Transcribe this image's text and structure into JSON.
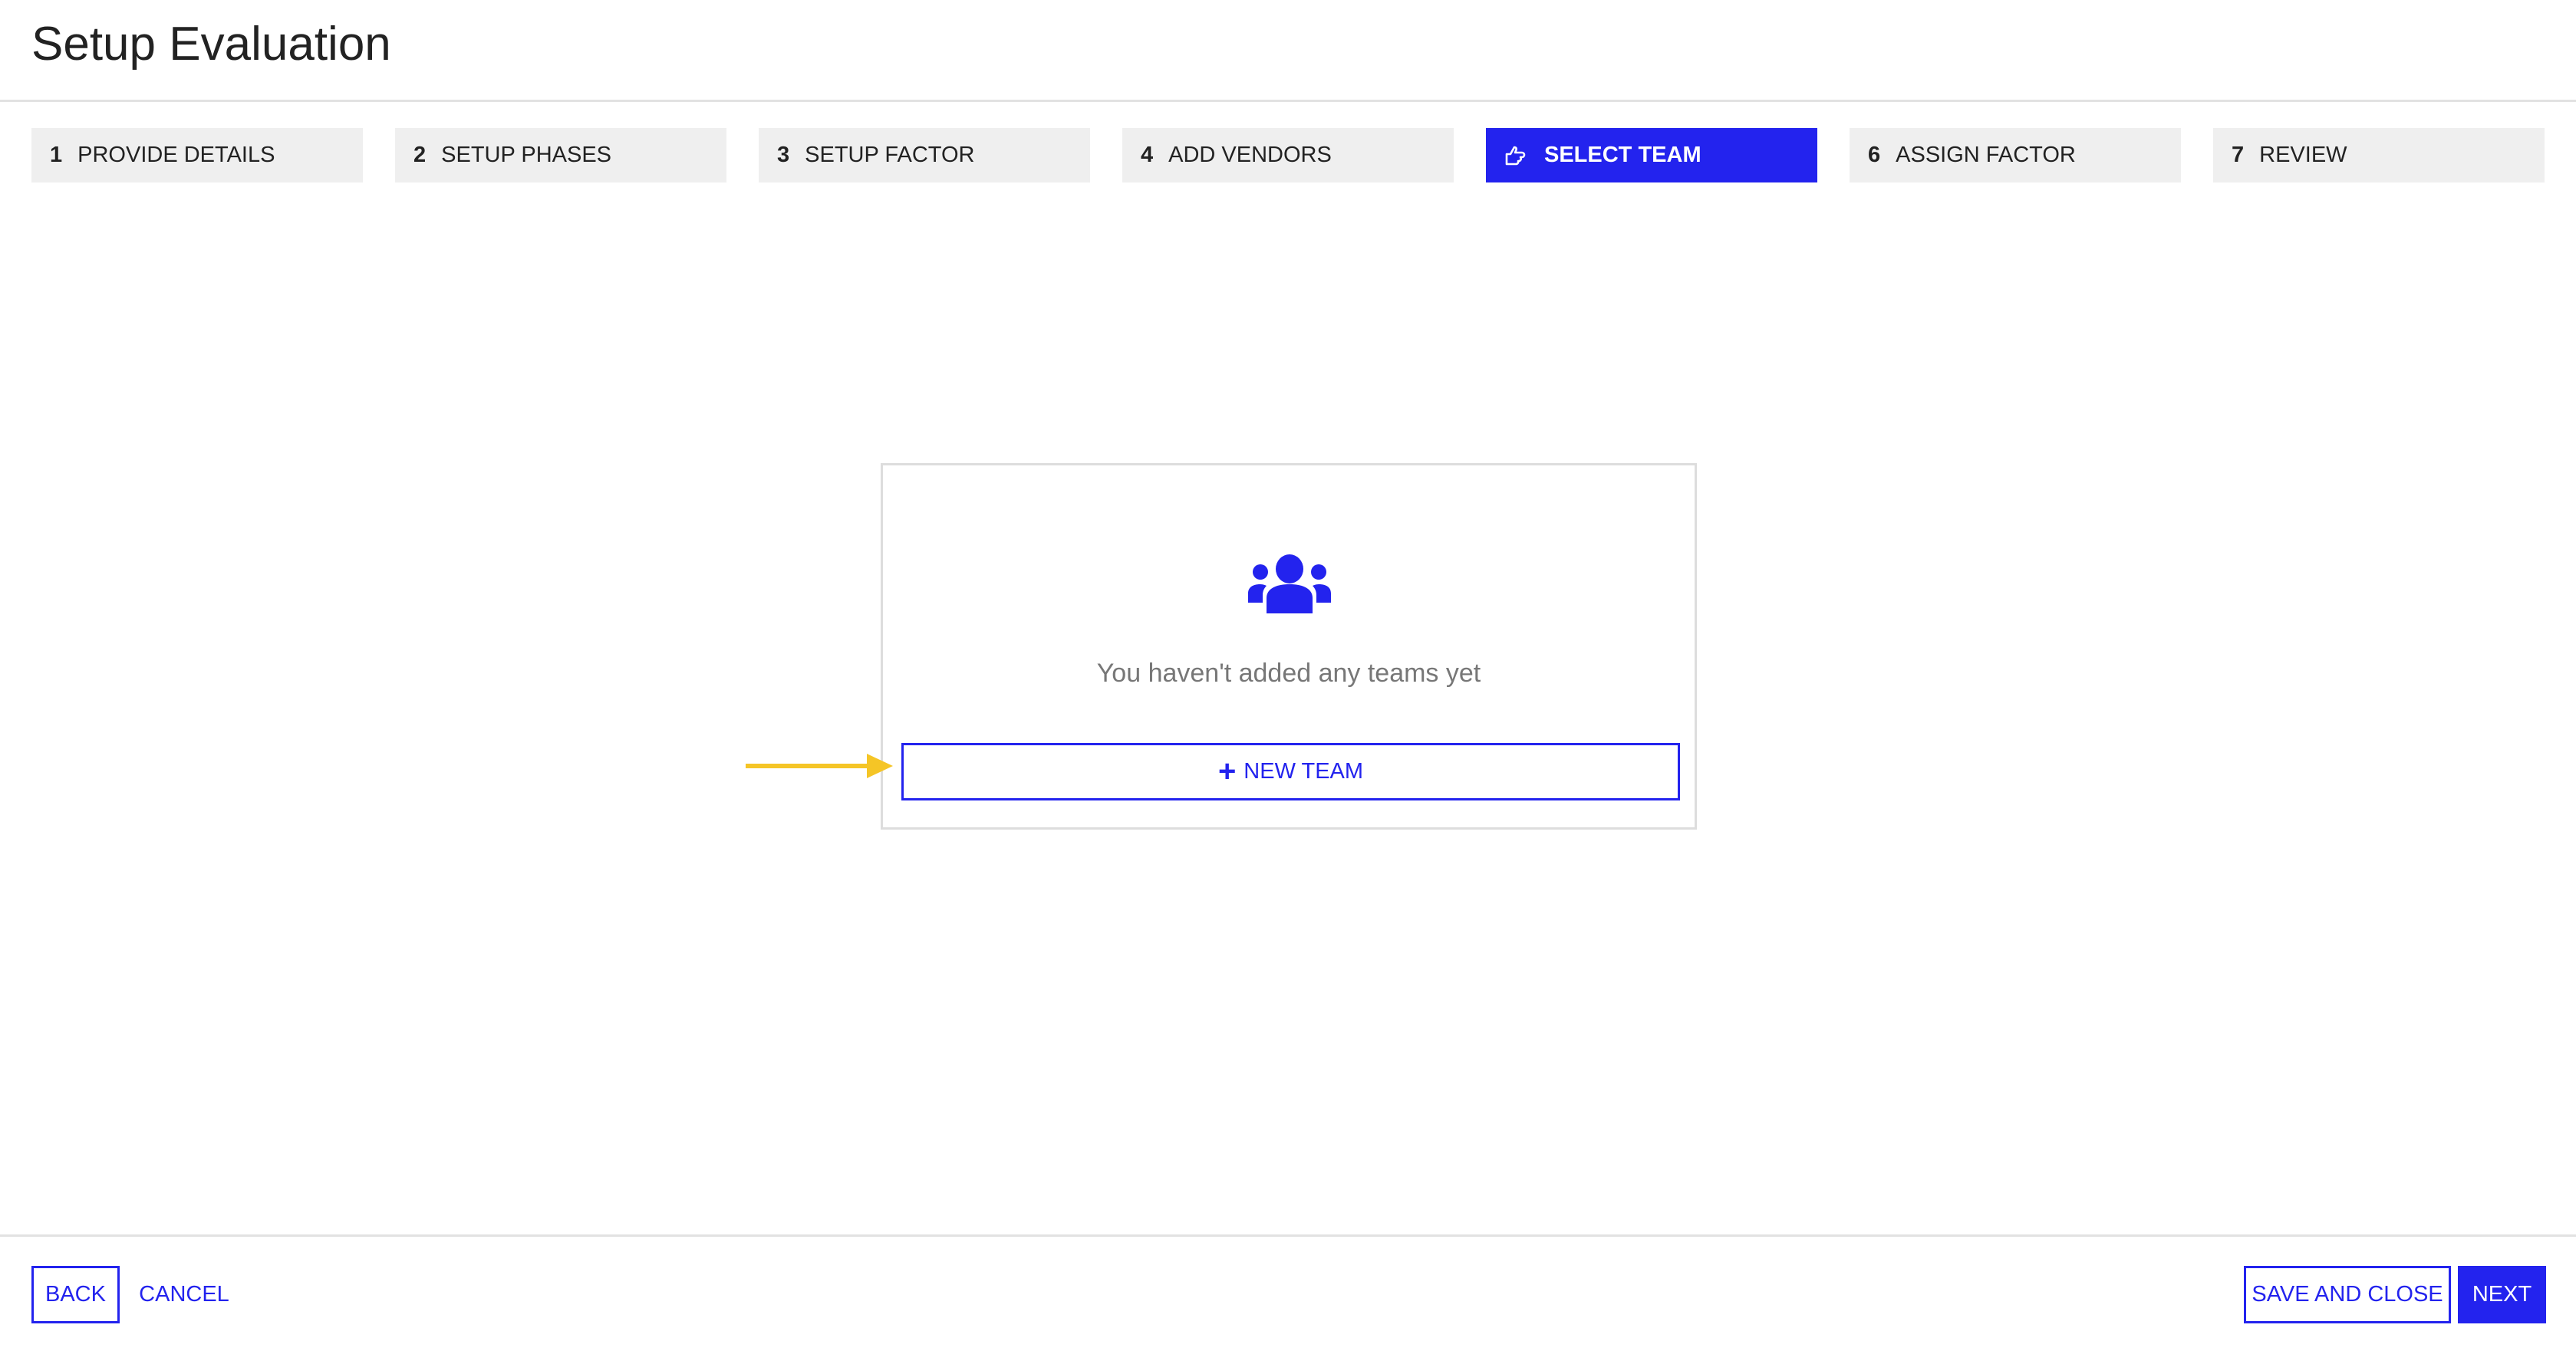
{
  "header": {
    "title": "Setup Evaluation"
  },
  "steps": [
    {
      "num": "1",
      "label": "PROVIDE DETAILS",
      "active": false
    },
    {
      "num": "2",
      "label": "SETUP PHASES",
      "active": false
    },
    {
      "num": "3",
      "label": "SETUP FACTOR",
      "active": false
    },
    {
      "num": "4",
      "label": "ADD VENDORS",
      "active": false
    },
    {
      "num": "5",
      "label": "SELECT TEAM",
      "active": true,
      "icon": "hand-pointer-icon"
    },
    {
      "num": "6",
      "label": "ASSIGN FACTOR",
      "active": false
    },
    {
      "num": "7",
      "label": "REVIEW",
      "active": false
    }
  ],
  "empty_state": {
    "icon": "users-icon",
    "message": "You haven't added any teams yet",
    "button_label": "NEW TEAM",
    "button_icon": "plus-icon"
  },
  "annotation": {
    "icon": "arrow-right-icon",
    "color": "#f5c526"
  },
  "footer": {
    "back": "BACK",
    "cancel": "CANCEL",
    "save_close": "SAVE AND CLOSE",
    "next": "NEXT"
  },
  "colors": {
    "accent": "#2323ee",
    "step_bg": "#efefef"
  }
}
